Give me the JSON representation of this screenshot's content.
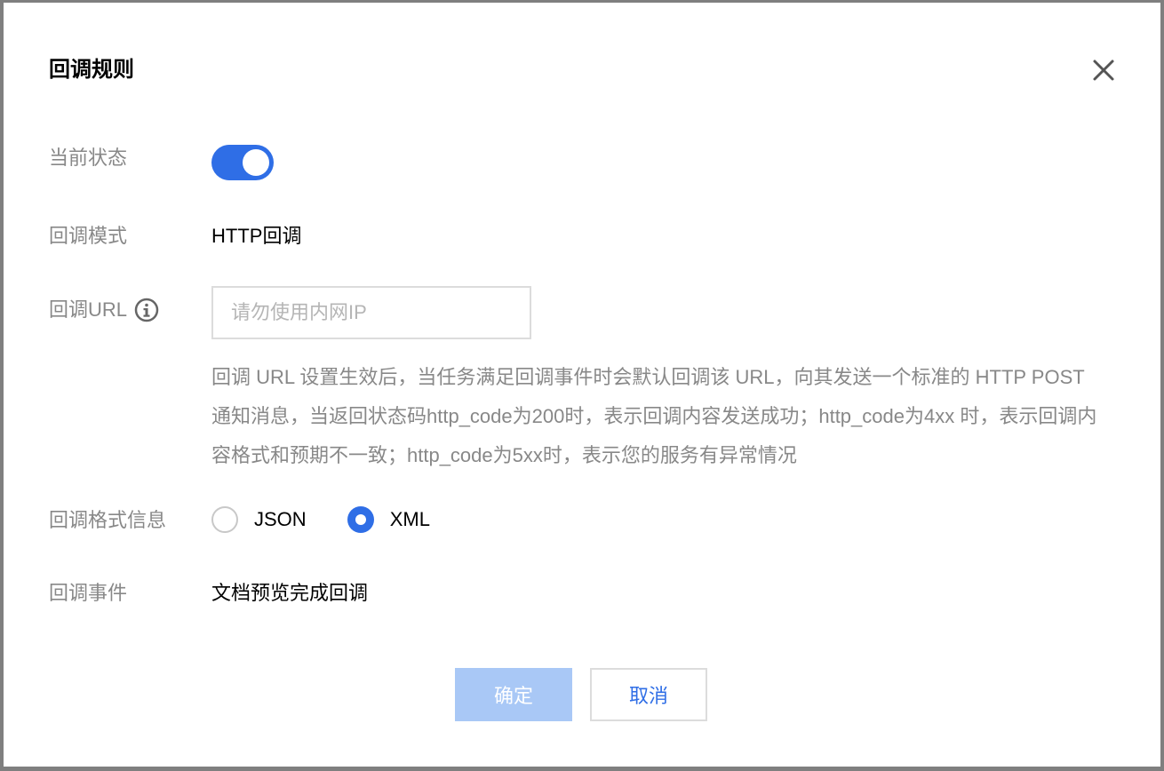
{
  "dialog": {
    "title": "回调规则",
    "close_icon": "close-icon"
  },
  "status": {
    "label": "当前状态",
    "enabled": true
  },
  "mode": {
    "label": "回调模式",
    "value": "HTTP回调"
  },
  "url": {
    "label": "回调URL",
    "info_icon": "info-icon",
    "placeholder": "请勿使用内网IP",
    "value": ""
  },
  "help_text": "回调 URL 设置生效后，当任务满足回调事件时会默认回调该 URL，向其发送一个标准的 HTTP POST 通知消息，当返回状态码http_code为200时，表示回调内容发送成功；http_code为4xx 时，表示回调内容格式和预期不一致；http_code为5xx时，表示您的服务有异常情况",
  "format": {
    "label": "回调格式信息",
    "options": [
      {
        "label": "JSON",
        "checked": false
      },
      {
        "label": "XML",
        "checked": true
      }
    ]
  },
  "event": {
    "label": "回调事件",
    "value": "文档预览完成回调"
  },
  "footer": {
    "confirm_label": "确定",
    "cancel_label": "取消"
  },
  "colors": {
    "accent": "#2f6ee6",
    "confirm_disabled": "#a9c8f6",
    "label_gray": "#888888"
  }
}
